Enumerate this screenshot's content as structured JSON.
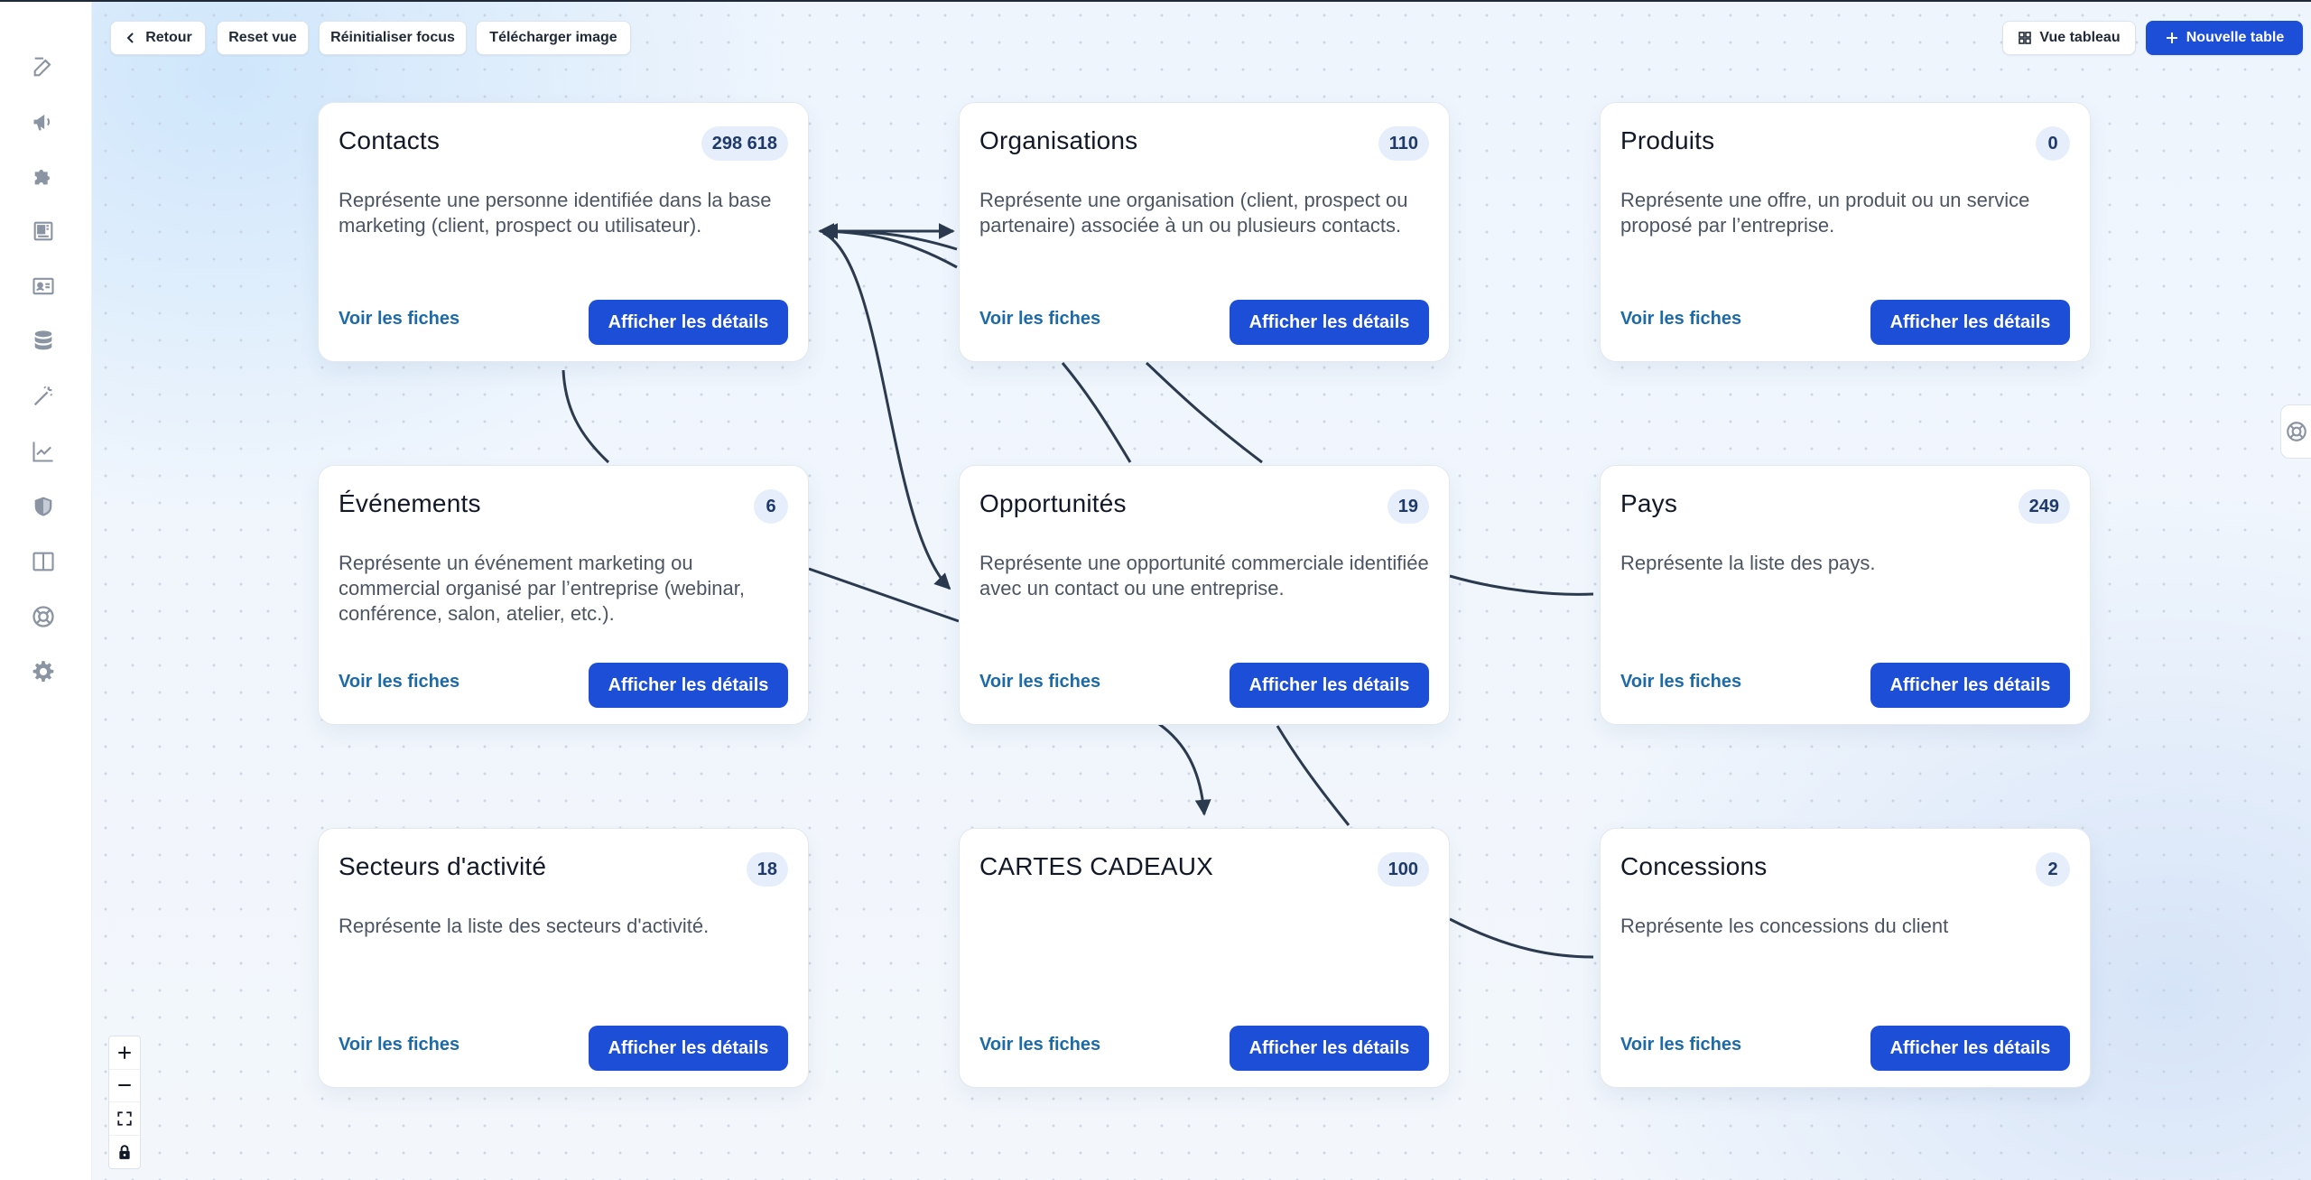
{
  "toolbar": {
    "back": "Retour",
    "reset_view": "Reset vue",
    "reset_focus": "Réinitialiser focus",
    "download": "Télécharger image",
    "table_view": "Vue tableau",
    "new_table": "Nouvelle table"
  },
  "sidebar": {
    "icons": [
      "edit-icon",
      "megaphone-icon",
      "puzzle-icon",
      "layout-icon",
      "contact-card-icon",
      "database-icon",
      "magic-wand-icon",
      "chart-line-icon",
      "shield-icon",
      "columns-icon",
      "lifebuoy-icon",
      "gear-icon"
    ]
  },
  "cards": [
    {
      "title": "Contacts",
      "count": "298 618",
      "description": "Représente une personne identifiée dans la base marketing (client, prospect ou utilisateur).",
      "link": "Voir les fiches",
      "button": "Afficher les détails"
    },
    {
      "title": "Organisations",
      "count": "110",
      "description": "Représente une organisation (client, prospect ou partenaire) associée à un ou plusieurs contacts.",
      "link": "Voir les fiches",
      "button": "Afficher les détails"
    },
    {
      "title": "Produits",
      "count": "0",
      "description": "Représente une offre, un produit ou un service proposé par l’entreprise.",
      "link": "Voir les fiches",
      "button": "Afficher les détails"
    },
    {
      "title": "Événements",
      "count": "6",
      "description": "Représente un événement marketing ou commercial organisé par l’entreprise (webinar, conférence, salon, atelier, etc.).",
      "link": "Voir les fiches",
      "button": "Afficher les détails"
    },
    {
      "title": "Opportunités",
      "count": "19",
      "description": "Représente une opportunité commerciale identifiée avec un contact ou une entreprise.",
      "link": "Voir les fiches",
      "button": "Afficher les détails"
    },
    {
      "title": "Pays",
      "count": "249",
      "description": "Représente la liste des pays.",
      "link": "Voir les fiches",
      "button": "Afficher les détails"
    },
    {
      "title": "Secteurs d'activité",
      "count": "18",
      "description": "Représente la liste des secteurs d'activité.",
      "link": "Voir les fiches",
      "button": "Afficher les détails"
    },
    {
      "title": "CARTES CADEAUX",
      "count": "100",
      "description": "",
      "link": "Voir les fiches",
      "button": "Afficher les détails"
    },
    {
      "title": "Concessions",
      "count": "2",
      "description": "Représente les concessions du client",
      "link": "Voir les fiches",
      "button": "Afficher les détails"
    }
  ],
  "colors": {
    "primary": "#1d4ed8",
    "link": "#1c6aa8",
    "edge": "#2b3a4e",
    "badge_bg": "#e6eefb"
  }
}
